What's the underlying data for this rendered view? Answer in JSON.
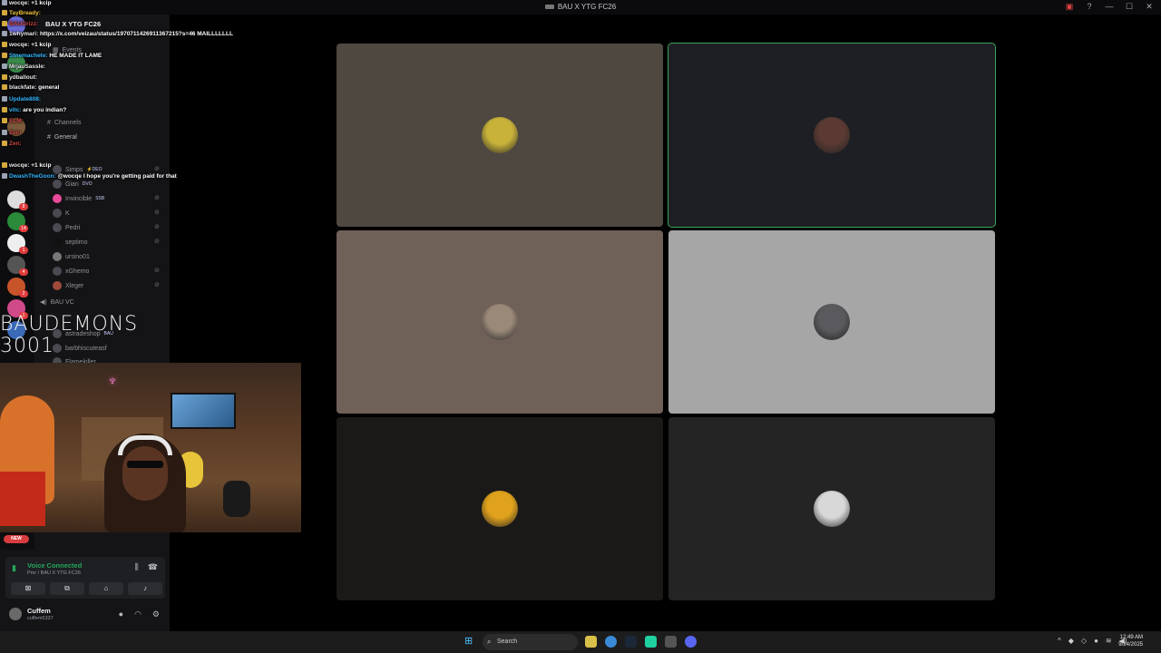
{
  "window": {
    "title": "BAU X YTG FC26"
  },
  "chat": [
    {
      "user": "wocqe:",
      "text": "+1 kcip",
      "color": "#e8e8e8"
    },
    {
      "user": "TayBready:",
      "text": "",
      "color": "#f0c53a"
    },
    {
      "user": "BAUGrizz:",
      "text": "",
      "color": "#d04545"
    },
    {
      "user": "1whymari:",
      "text": "https://x.com/veizau/status/1970711426911367215?s=46 MAILLLLLLL",
      "color": "#e8e8e8"
    },
    {
      "user": "wocqe:",
      "text": "+1 kcip",
      "color": "#e8e8e8"
    },
    {
      "user": "Stnemachete:",
      "text": "HE MADE IT LAME",
      "color": "#35b7ff"
    },
    {
      "user": "MrjauSassle:",
      "text": "",
      "color": "#e8e8e8"
    },
    {
      "user": "ydballout:",
      "text": "",
      "color": "#e8e8e8"
    },
    {
      "user": "blackfate:",
      "text": "general",
      "color": "#e8e8e8"
    },
    {
      "user": "Update808:",
      "text": "",
      "color": "#35b7ff"
    },
    {
      "user": "vitc:",
      "text": "are you indian?",
      "color": "#35b7ff"
    },
    {
      "user": "ELM:",
      "text": "",
      "color": "#d04545"
    },
    {
      "user": "Zen:",
      "text": "",
      "color": "#d04545"
    },
    {
      "user": "Zen:",
      "text": "",
      "color": "#d04545"
    },
    {
      "user": "wocqe:",
      "text": "+1 kcip",
      "color": "#e8e8e8"
    },
    {
      "user": "DwashTheGoon:",
      "text": "@wocqe I hope you're getting paid for that",
      "color": "#35b7ff"
    }
  ],
  "sidebar": {
    "server_title": "BAU X YTG FC26",
    "events_label": "Events",
    "channels_label": "Channels",
    "general_label": "General",
    "bau_vc_label": "BAU VC",
    "members": [
      {
        "name": "Simps",
        "tag": "⚡DEO"
      },
      {
        "name": "Gian",
        "tag": "DVO"
      },
      {
        "name": "Invincible",
        "tag": "SSB"
      },
      {
        "name": "K",
        "tag": ""
      },
      {
        "name": "Pedri",
        "tag": ""
      },
      {
        "name": "septimo",
        "tag": ""
      },
      {
        "name": "ursino01",
        "tag": ""
      },
      {
        "name": "xGhemo",
        "tag": ""
      },
      {
        "name": "Xleger",
        "tag": ""
      }
    ],
    "bau_members": [
      {
        "name": "astradeshop",
        "tag": "BAU"
      },
      {
        "name": "barbhiscuteasf",
        "tag": ""
      },
      {
        "name": "Flamekiller",
        "tag": ""
      }
    ]
  },
  "overlay": {
    "brand_line1": "BAUDEMONS",
    "brand_line2": "3001"
  },
  "new_badge": "NEW",
  "voice": {
    "status": "Voice Connected",
    "location": "Pmr / BAU X YTG FC26"
  },
  "user": {
    "name": "Cuffem",
    "tag": "cuffem5337"
  },
  "tiles": [
    {
      "bg": "#4e4841",
      "avatar": "#c8b23a",
      "active": false
    },
    {
      "bg": "#1e1f24",
      "avatar": "#5a3a32",
      "active": true
    },
    {
      "bg": "#6f6058",
      "avatar": "#9a8878",
      "active": false
    },
    {
      "bg": "#a6a6a6",
      "avatar": "#5a5a5e",
      "active": false
    },
    {
      "bg": "#1a1918",
      "avatar": "#e0a21c",
      "active": false
    },
    {
      "bg": "#252424",
      "avatar": "#d8d8d8",
      "active": false
    }
  ],
  "taskbar": {
    "search_label": "Search",
    "time": "12:49 AM",
    "date": "9/24/2025"
  },
  "colors": {
    "accent_green": "#3ba55d",
    "discord_red": "#d83c3e"
  }
}
